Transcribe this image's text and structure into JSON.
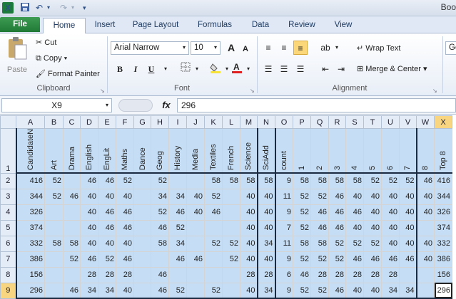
{
  "title": {
    "doc": "Boo",
    "quick_access": [
      "x-logo-icon",
      "save-icon",
      "undo-icon",
      "redo-icon",
      "customize-icon"
    ]
  },
  "tabs": [
    {
      "label": "File"
    },
    {
      "label": "Home"
    },
    {
      "label": "Insert"
    },
    {
      "label": "Page Layout"
    },
    {
      "label": "Formulas"
    },
    {
      "label": "Data"
    },
    {
      "label": "Review"
    },
    {
      "label": "View"
    }
  ],
  "ribbon": {
    "clipboard": {
      "label": "Clipboard",
      "paste": "Paste",
      "cut": "Cut",
      "copy": "Copy",
      "copy_arrow": "▾",
      "format_painter": "Format Painter"
    },
    "font": {
      "label": "Font",
      "name": "Arial Narrow",
      "size": "10",
      "bold": "B",
      "italic": "I",
      "underline": "U",
      "grow": "A",
      "shrink": "A"
    },
    "alignment": {
      "label": "Alignment",
      "wrap": "Wrap Text",
      "merge": "Merge & Center",
      "merge_arrow": "▾"
    },
    "number": {
      "label": "Ge"
    }
  },
  "formula_bar": {
    "name_box": "X9",
    "fx": "fx",
    "value": "296"
  },
  "sheet": {
    "columns": [
      "A",
      "B",
      "C",
      "D",
      "E",
      "F",
      "G",
      "H",
      "I",
      "J",
      "K",
      "L",
      "M",
      "N",
      "O",
      "P",
      "Q",
      "R",
      "S",
      "T",
      "U",
      "V",
      "W",
      "X"
    ],
    "header_row": {
      "row": "1",
      "cells": [
        "CandidateNo.",
        "Art",
        "Drama",
        "English",
        "EngLit",
        "Maths",
        "Dance",
        "Geog",
        "History",
        "Media",
        "Textiles",
        "French",
        "Science",
        "SciAdd",
        "count",
        "1",
        "2",
        "3",
        "4",
        "5",
        "6",
        "7",
        "8",
        "Top 8"
      ]
    },
    "rows": [
      {
        "row": "2",
        "cells": [
          "416",
          "52",
          "",
          "46",
          "46",
          "52",
          "",
          "52",
          "",
          "",
          "58",
          "58",
          "58",
          "58",
          "9",
          "58",
          "58",
          "58",
          "58",
          "52",
          "52",
          "52",
          "46",
          "416"
        ]
      },
      {
        "row": "3",
        "cells": [
          "344",
          "52",
          "46",
          "40",
          "40",
          "40",
          "",
          "34",
          "34",
          "40",
          "52",
          "",
          "40",
          "40",
          "11",
          "52",
          "52",
          "46",
          "40",
          "40",
          "40",
          "40",
          "40",
          "344"
        ]
      },
      {
        "row": "4",
        "cells": [
          "326",
          "",
          "",
          "40",
          "46",
          "46",
          "",
          "52",
          "46",
          "40",
          "46",
          "",
          "40",
          "40",
          "9",
          "52",
          "46",
          "46",
          "46",
          "40",
          "40",
          "40",
          "40",
          "326"
        ]
      },
      {
        "row": "5",
        "cells": [
          "374",
          "",
          "",
          "40",
          "46",
          "46",
          "",
          "46",
          "52",
          "",
          "",
          "",
          "40",
          "40",
          "7",
          "52",
          "46",
          "46",
          "40",
          "40",
          "40",
          "40",
          "",
          "374"
        ]
      },
      {
        "row": "6",
        "cells": [
          "332",
          "58",
          "58",
          "40",
          "40",
          "40",
          "",
          "58",
          "34",
          "",
          "52",
          "52",
          "40",
          "34",
          "11",
          "58",
          "58",
          "52",
          "52",
          "52",
          "40",
          "40",
          "40",
          "332"
        ]
      },
      {
        "row": "7",
        "cells": [
          "386",
          "",
          "52",
          "46",
          "52",
          "46",
          "",
          "",
          "46",
          "46",
          "",
          "52",
          "40",
          "40",
          "9",
          "52",
          "52",
          "52",
          "46",
          "46",
          "46",
          "46",
          "40",
          "386"
        ]
      },
      {
        "row": "8",
        "cells": [
          "156",
          "",
          "",
          "28",
          "28",
          "28",
          "",
          "46",
          "",
          "",
          "",
          "",
          "28",
          "28",
          "6",
          "46",
          "28",
          "28",
          "28",
          "28",
          "28",
          "",
          "",
          "156"
        ]
      },
      {
        "row": "9",
        "cells": [
          "296",
          "",
          "46",
          "34",
          "34",
          "40",
          "",
          "46",
          "52",
          "",
          "52",
          "",
          "40",
          "34",
          "9",
          "52",
          "52",
          "46",
          "40",
          "40",
          "34",
          "34",
          "",
          "296"
        ]
      }
    ]
  }
}
